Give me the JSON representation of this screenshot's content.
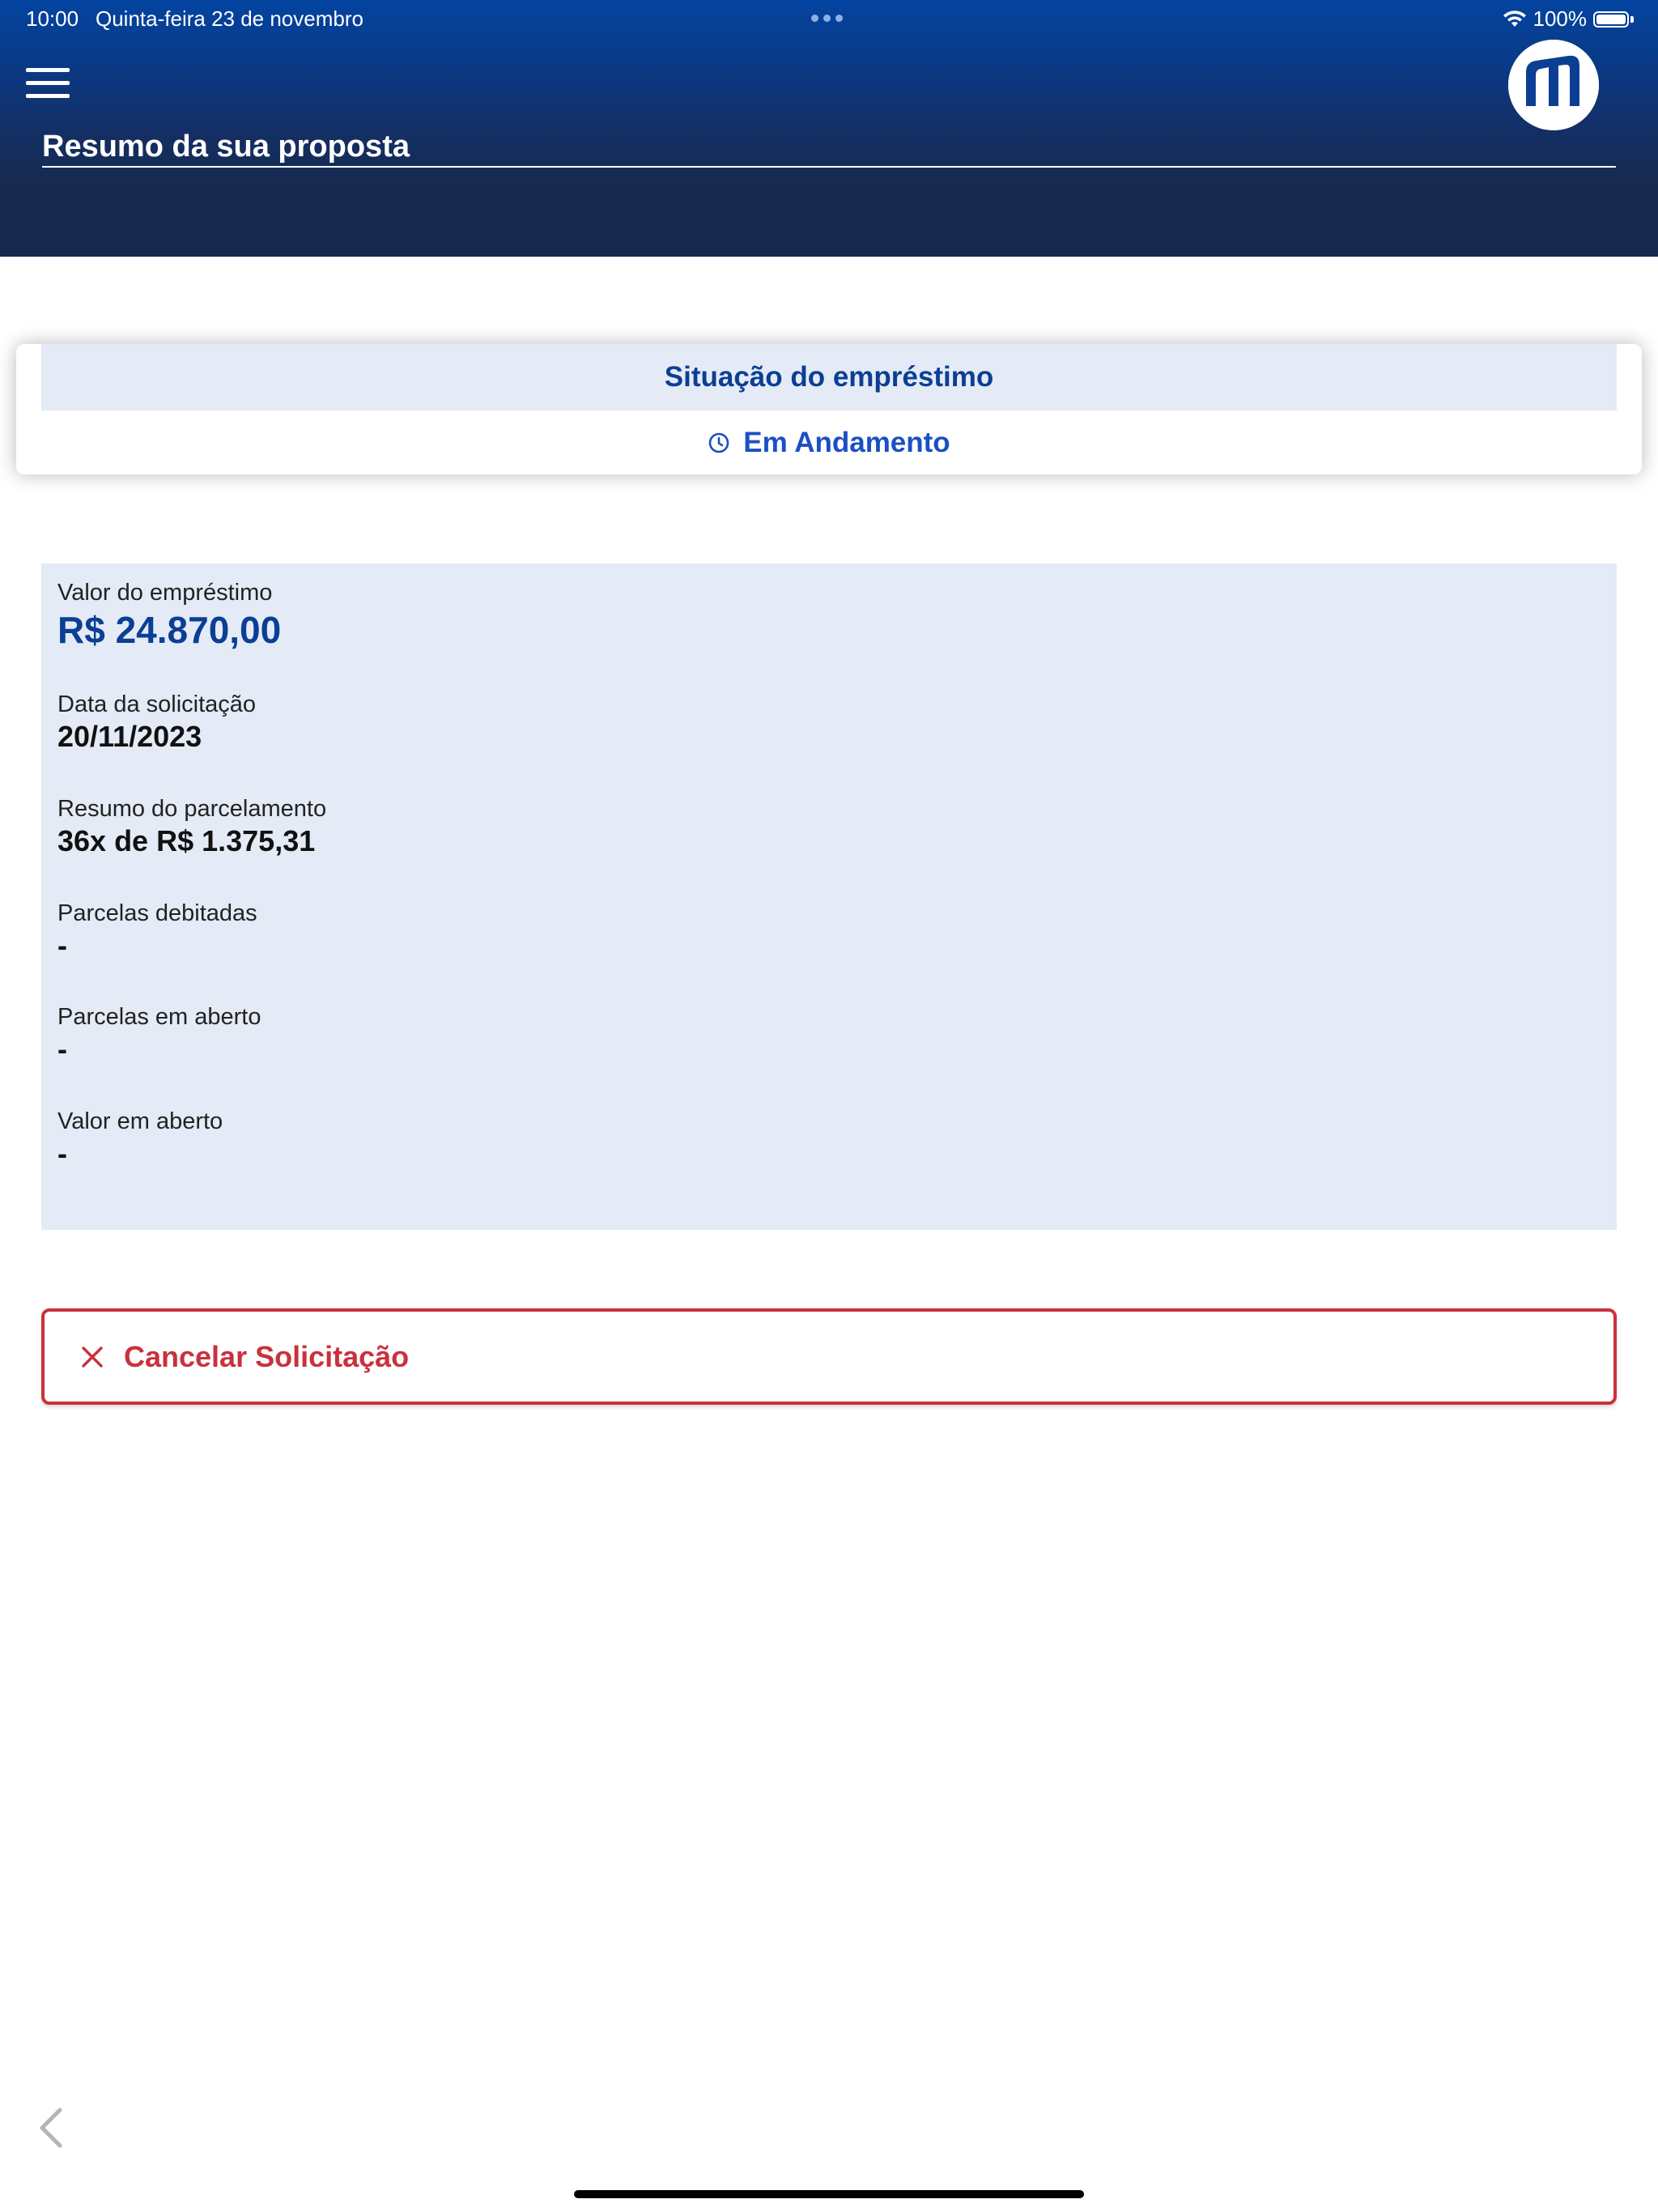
{
  "status_bar": {
    "time": "10:00",
    "date": "Quinta-feira 23 de novembro",
    "battery": "100%",
    "icons": [
      "wifi-icon",
      "battery-icon"
    ]
  },
  "header": {
    "title": "Resumo da sua proposta",
    "menu_icon": "hamburger-menu-icon",
    "logo": "bank-logo"
  },
  "loan_status": {
    "heading": "Situação do empréstimo",
    "status": "Em Andamento",
    "status_icon": "clock-icon"
  },
  "details": {
    "loan_value": {
      "label": "Valor do empréstimo",
      "value": "R$ 24.870,00"
    },
    "request_date": {
      "label": "Data da solicitação",
      "value": "20/11/2023"
    },
    "installments_summary": {
      "label": "Resumo do parcelamento",
      "value": "36x de R$ 1.375,31"
    },
    "debited_installments": {
      "label": "Parcelas debitadas",
      "value": "-"
    },
    "open_installments": {
      "label": "Parcelas em aberto",
      "value": "-"
    },
    "open_amount": {
      "label": "Valor em aberto",
      "value": "-"
    }
  },
  "actions": {
    "cancel_label": "Cancelar Solicitação",
    "cancel_icon": "close-icon"
  },
  "nav": {
    "back_icon": "chevron-left-icon"
  },
  "colors": {
    "header_top": "#0344a0",
    "header_bottom": "#172a4e",
    "panel_bg": "#e4ebf6",
    "primary_text": "#0b3f94",
    "status_text": "#1b4fc4",
    "danger": "#c9313c"
  }
}
